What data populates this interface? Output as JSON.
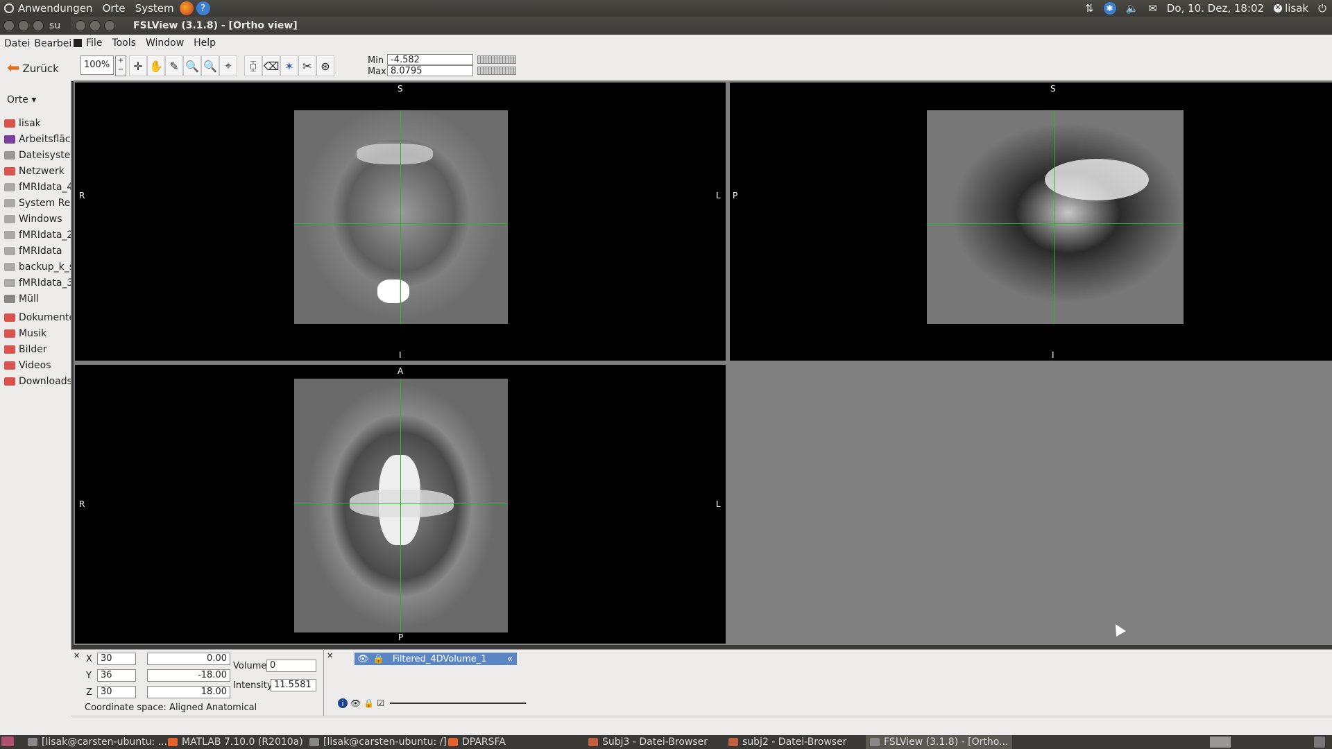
{
  "top_panel": {
    "menus": [
      "Anwendungen",
      "Orte",
      "System"
    ],
    "datetime": "Do, 10. Dez, 18:02",
    "user": "lisak"
  },
  "nautilus": {
    "title_partial": "su",
    "menu": [
      "Datei",
      "Bearbei"
    ],
    "back_label": "Zurück",
    "places_header": "Orte ▾",
    "places": [
      {
        "label": "lisak",
        "color": "#d9534f"
      },
      {
        "label": "Arbeitsfläch",
        "color": "#7b3fa0"
      },
      {
        "label": "Dateisyster",
        "color": "#999999"
      },
      {
        "label": "Netzwerk",
        "color": "#d9534f"
      },
      {
        "label": "fMRIdata_4",
        "color": "#aaaaaa"
      },
      {
        "label": "System Res",
        "color": "#aaaaaa"
      },
      {
        "label": "Windows",
        "color": "#aaaaaa"
      },
      {
        "label": "fMRIdata_2",
        "color": "#aaaaaa"
      },
      {
        "label": "fMRIdata",
        "color": "#aaaaaa"
      },
      {
        "label": "backup_k_s",
        "color": "#aaaaaa"
      },
      {
        "label": "fMRIdata_3",
        "color": "#aaaaaa"
      },
      {
        "label": "Müll",
        "color": "#888888"
      },
      {
        "label": "Dokumente",
        "color": "#d9534f"
      },
      {
        "label": "Musik",
        "color": "#d9534f"
      },
      {
        "label": "Bilder",
        "color": "#d9534f"
      },
      {
        "label": "Videos",
        "color": "#d9534f"
      },
      {
        "label": "Downloads",
        "color": "#d9534f"
      }
    ]
  },
  "fsl": {
    "title": "FSLView (3.1.8) - [Ortho view]",
    "menu": [
      "File",
      "Tools",
      "Window",
      "Help"
    ],
    "zoom": "100%",
    "min_label": "Min",
    "min_value": "-4.582",
    "max_label": "Max",
    "max_value": "8.0795",
    "views": {
      "coronal": {
        "top": "S",
        "bottom": "I",
        "left": "R",
        "right": "L"
      },
      "sagittal": {
        "top": "S",
        "bottom": "I",
        "left": "P"
      },
      "axial": {
        "top": "A",
        "bottom": "P",
        "left": "R",
        "right": "L"
      }
    },
    "coords": {
      "x_label": "X",
      "x_vox": "30",
      "x_mm": "0.00",
      "y_label": "Y",
      "y_vox": "36",
      "y_mm": "-18.00",
      "z_label": "Z",
      "z_vox": "30",
      "z_mm": "18.00",
      "coord_space": "Coordinate space: Aligned Anatomical"
    },
    "volume_label": "Volume",
    "volume_value": "0",
    "intensity_label": "Intensity",
    "intensity_value": "11.5581",
    "layer_name": "Filtered_4DVolume_1"
  },
  "taskbar": [
    {
      "label": "[lisak@carsten-ubuntu: ..."
    },
    {
      "label": "MATLAB  7.10.0 (R2010a)"
    },
    {
      "label": "[lisak@carsten-ubuntu: /]"
    },
    {
      "label": "DPARSFA"
    },
    {
      "label": "Subj3 - Datei-Browser"
    },
    {
      "label": "subj2 - Datei-Browser"
    },
    {
      "label": "FSLView (3.1.8) - [Ortho..."
    }
  ]
}
